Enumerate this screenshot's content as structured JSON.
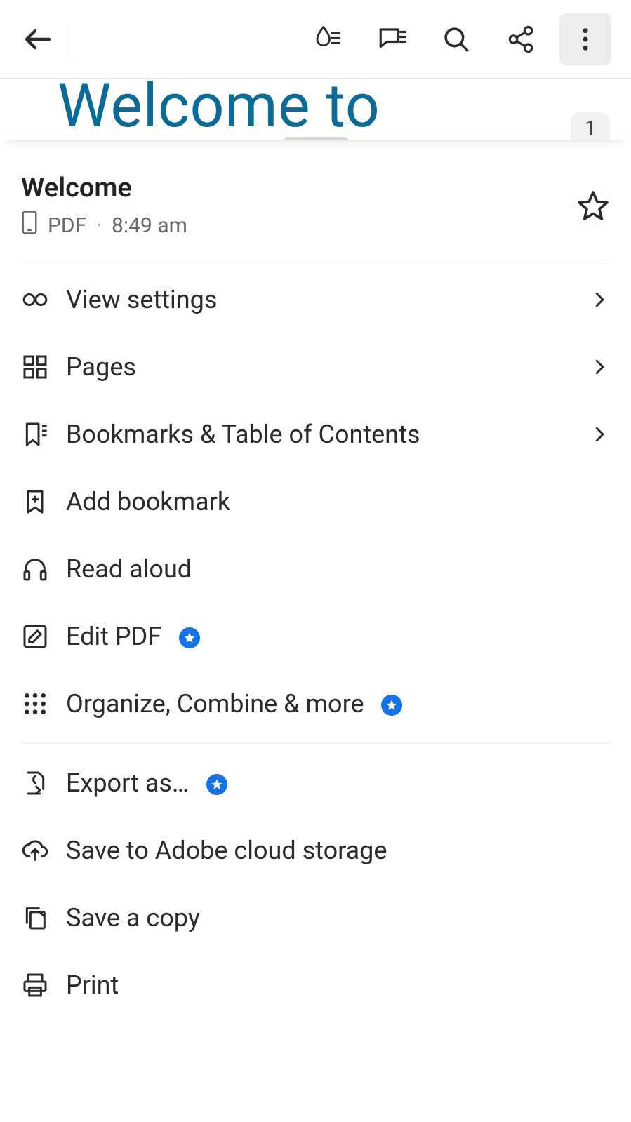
{
  "topbar": {
    "back": "Back"
  },
  "document": {
    "peek_title": "Welcome to",
    "page_current": "1"
  },
  "file": {
    "name": "Welcome",
    "type": "PDF",
    "time": "8:49 am"
  },
  "menu": {
    "view_settings": "View settings",
    "pages": "Pages",
    "bookmarks_toc": "Bookmarks & Table of Contents",
    "add_bookmark": "Add bookmark",
    "read_aloud": "Read aloud",
    "edit_pdf": "Edit PDF",
    "organize_combine": "Organize, Combine & more",
    "export_as": "Export as…",
    "save_cloud": "Save to Adobe cloud storage",
    "save_copy": "Save a copy",
    "print": "Print"
  }
}
